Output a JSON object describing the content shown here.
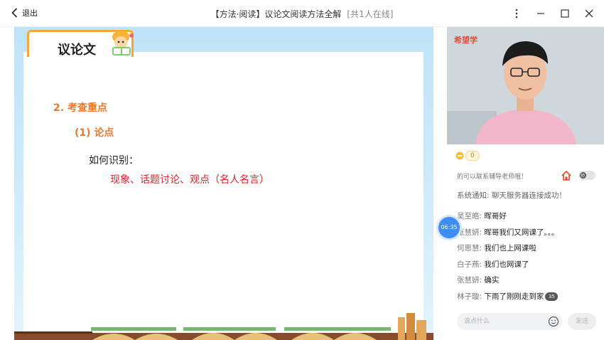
{
  "titlebar": {
    "exit_label": "退出",
    "title": "【方法·阅读】议论文阅读方法全解",
    "online": "[共1人在线]"
  },
  "slide": {
    "tab_label": "议论文",
    "line1": "2.  考查重点",
    "line2": "(1) 论点",
    "line3": "如何识别：",
    "line4": "现象、话题讨论、观点（名人名言）"
  },
  "panel": {
    "brand": "希望学",
    "coin_count": "0",
    "notice": "的可以联系辅导老师哦！",
    "toggle_label": "师",
    "system_notice": "系统通知: 聊天服务器连接成功！",
    "messages": [
      {
        "user": "吴至皓:",
        "text": "晖哥好"
      },
      {
        "user": "张慧妍:",
        "text": "晖哥我们又网课了。。。"
      },
      {
        "user": "何思慧:",
        "text": "我们也上网课啦"
      },
      {
        "user": "白子燕:",
        "text": "我们也网课了"
      },
      {
        "user": "张慧妍:",
        "text": "确实"
      },
      {
        "user": "林子璇:",
        "text": "下雨了刚刚走到家"
      }
    ],
    "emoji_badge": "35",
    "timer": "06:35",
    "input_placeholder": "说点什么",
    "send_label": "发送"
  },
  "colors": {
    "accent_orange": "#e77a2b",
    "highlight_red": "#d8242a",
    "brand_red": "#e64a3b",
    "timer_blue": "#3f8cf4"
  }
}
